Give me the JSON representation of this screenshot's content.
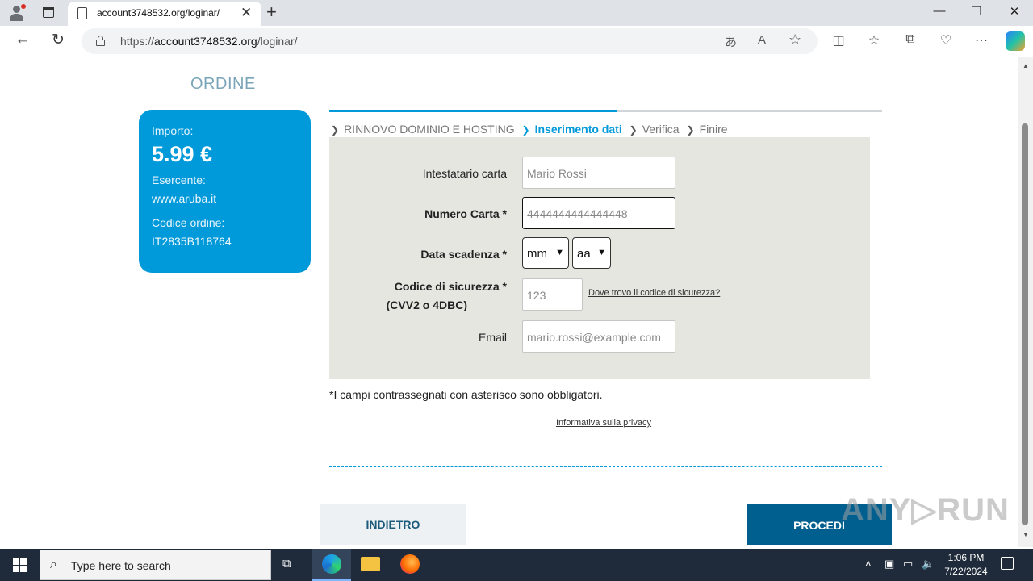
{
  "browser": {
    "tab_title": "account3748532.org/loginar/",
    "url_prefix": "https://",
    "url_host": "account3748532.org",
    "url_path": "/loginar/"
  },
  "order": {
    "title": "ORDINE",
    "amount_label": "Importo:",
    "amount": "5.99 €",
    "merchant_label": "Esercente:",
    "merchant": "www.aruba.it",
    "order_code_label": "Codice ordine:",
    "order_code": "IT2835B118764"
  },
  "steps": {
    "step1": "RINNOVO DOMINIO E HOSTING",
    "step2": "Inserimento dati",
    "step3": "Verifica",
    "step4": "Finire",
    "progress_fraction": 0.52
  },
  "form": {
    "holder_label": "Intestatario carta",
    "holder_placeholder": "Mario Rossi",
    "card_label": "Numero Carta *",
    "card_placeholder": "4444444444444448",
    "expiry_label": "Data scadenza *",
    "month_value": "mm",
    "year_value": "aa",
    "cvv_label": "Codice di sicurezza *",
    "cvv_label2": "(CVV2 o 4DBC)",
    "cvv_placeholder": "123",
    "cvv_help_link": "Dove trovo il codice di sicurezza?",
    "email_label": "Email",
    "email_placeholder": "mario.rossi@example.com"
  },
  "footer": {
    "required_note": "*I campi contrassegnati con asterisco sono obbligatori.",
    "privacy_link": "Informativa sulla privacy",
    "back_button": "INDIETRO",
    "next_button": "PROCEDI",
    "watermark": "ANY▷RUN"
  },
  "taskbar": {
    "search_placeholder": "Type here to search",
    "time": "1:06 PM",
    "date": "7/22/2024"
  }
}
